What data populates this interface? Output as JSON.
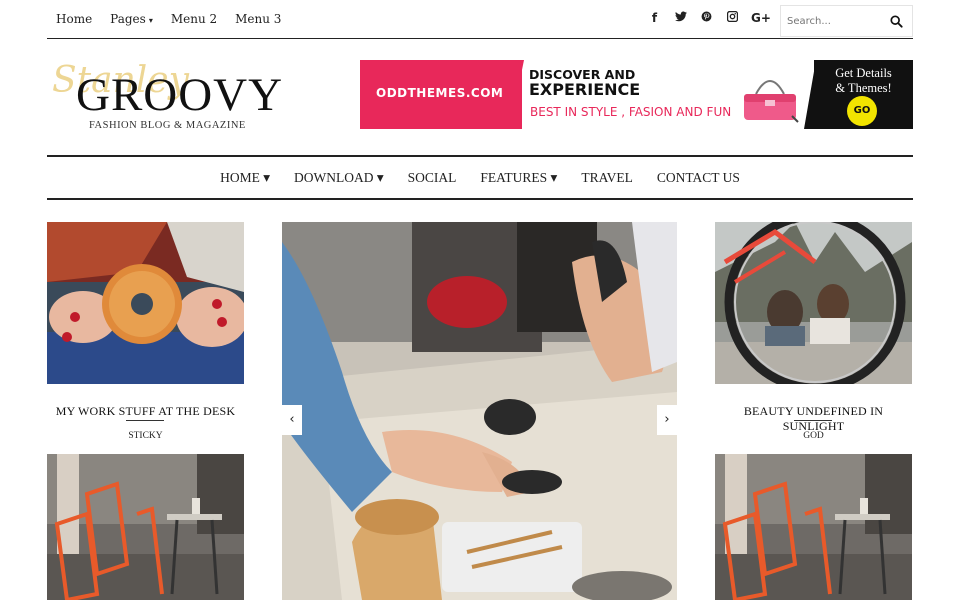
{
  "topnav": {
    "items": [
      {
        "label": "Home"
      },
      {
        "label": "Pages",
        "caret": "▾"
      },
      {
        "label": "Menu 2"
      },
      {
        "label": "Menu 3"
      }
    ]
  },
  "social": {
    "facebook": "f",
    "twitter": "t",
    "pinterest": "p",
    "instagram": "i",
    "google": "G+"
  },
  "search": {
    "placeholder": "Search..."
  },
  "logo": {
    "script": "Stanley",
    "title": "GROOVY",
    "subtitle": "FASHION BLOG & MAGAZINE"
  },
  "banner": {
    "brand": "ODDTHEMES.COM",
    "heading_line1": "DISCOVER AND",
    "heading_line2": "EXPERIENCE",
    "tagline": "BEST IN STYLE , FASION AND FUN",
    "cta_line1": "Get Details",
    "cta_line2": "& Themes!",
    "go": "GO"
  },
  "mainnav": {
    "items": [
      {
        "label": "HOME ▾"
      },
      {
        "label": "DOWNLOAD ▾"
      },
      {
        "label": "SOCIAL"
      },
      {
        "label": "FEATURES ▾"
      },
      {
        "label": "TRAVEL"
      },
      {
        "label": "CONTACT US"
      }
    ]
  },
  "posts": {
    "left_top": {
      "title": "MY WORK STUFF AT THE DESK",
      "category": "STICKY"
    },
    "right_top": {
      "title": "BEAUTY UNDEFINED IN SUNLIGHT",
      "category": "GOD"
    }
  },
  "slider": {
    "prev": "‹",
    "next": "›"
  },
  "colors": {
    "accent": "#e8285a",
    "dark": "#111111",
    "go": "#f2e400"
  }
}
